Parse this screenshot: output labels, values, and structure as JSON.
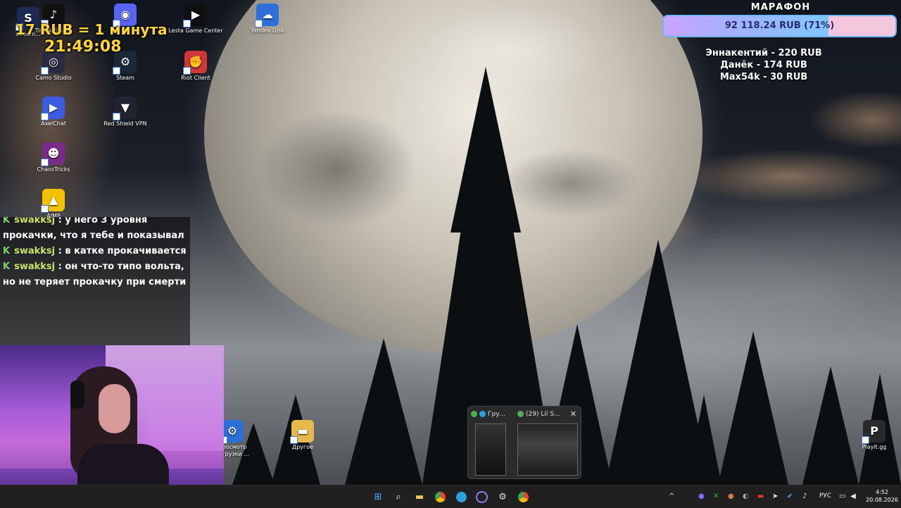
{
  "desktop": {
    "icons": [
      {
        "label": "stream...",
        "color": "#1d2b53",
        "glyph": "S"
      },
      {
        "label": "TikTok Studio",
        "color": "#111111",
        "glyph": "♪"
      },
      {
        "label": "",
        "color": "#5865f2",
        "glyph": "◉"
      },
      {
        "label": "Lesta Game Center",
        "color": "#101010",
        "glyph": "▶"
      },
      {
        "label": "Yandex Disk",
        "color": "#2f6fdc",
        "glyph": "☁"
      },
      {
        "label": "Camo Studio",
        "color": "#2a2a40",
        "glyph": "◎"
      },
      {
        "label": "Steam",
        "color": "#1b2838",
        "glyph": "⚙"
      },
      {
        "label": "Riot Client",
        "color": "#d13639",
        "glyph": "✊"
      },
      {
        "label": "AxelChat",
        "color": "#3c5ce0",
        "glyph": "▶"
      },
      {
        "label": "Red Shield VPN",
        "color": "#222233",
        "glyph": "▼"
      },
      {
        "label": "ChaosTricks",
        "color": "#7a2a8a",
        "glyph": "☻"
      },
      {
        "label": "AIMP",
        "color": "#f2c200",
        "glyph": "▲"
      },
      {
        "label": "Просмотр загрузки ...",
        "color": "#2a6fd6",
        "glyph": "⚙"
      },
      {
        "label": "Другое",
        "color": "#e7b84a",
        "glyph": "▬"
      },
      {
        "label": "Playit.gg",
        "color": "#2a2a2a",
        "glyph": "P"
      }
    ]
  },
  "stream_overlay": {
    "rate": "17 RUB = 1 минута",
    "timer": "21:49:08",
    "marathon_title": "МАРАФОН",
    "progress_label": "92 118.24 RUB (71%)",
    "progress_fraction": 0.71,
    "donors": [
      "Эннакентий - 220 RUB",
      "Данёк - 174 RUB",
      "Max54k - 30 RUB"
    ]
  },
  "chat": {
    "messages": [
      {
        "user": "swakksj",
        "text": ": у него 3 уровня прокачки, что я тебе и показывал"
      },
      {
        "user": "swakksj",
        "text": ": в катке прокачивается"
      },
      {
        "user": "swakksj",
        "text": ": он что-то типо вольта, но не теряет прокачку при смерти"
      }
    ]
  },
  "taskbar_preview": {
    "window1_title": "Гру...",
    "window2_title": "(29) Lil S...",
    "close_glyph": "✕"
  },
  "taskbar": {
    "apps": [
      "start-icon",
      "search-icon",
      "file-explorer-icon",
      "chrome-icon",
      "telegram-icon",
      "obs-icon",
      "app-icon",
      "chrome-icon"
    ],
    "tray_language": "РУС",
    "time": "4:52",
    "date": "20.08.2026"
  }
}
